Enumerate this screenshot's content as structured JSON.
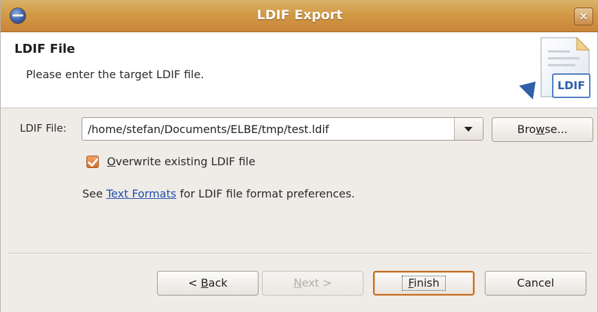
{
  "window": {
    "title": "LDIF Export",
    "close_label": "×"
  },
  "header": {
    "title": "LDIF File",
    "description": "Please enter the target LDIF file.",
    "graphic_label": "LDIF"
  },
  "file_field": {
    "label": "LDIF File:",
    "value": "/home/stefan/Documents/ELBE/tmp/test.ldif"
  },
  "browse_button": {
    "pre": "Bro",
    "mnemonic": "w",
    "post": "se..."
  },
  "overwrite": {
    "checked": true,
    "label_mnemonic": "O",
    "label_rest": "verwrite existing LDIF file"
  },
  "info": {
    "prefix": "See ",
    "link": "Text Formats",
    "suffix": " for LDIF file format preferences."
  },
  "buttons": {
    "back": {
      "pre": "< ",
      "mnemonic": "B",
      "post": "ack",
      "enabled": true
    },
    "next": {
      "pre": "",
      "mnemonic": "N",
      "post": "ext >",
      "enabled": false
    },
    "finish": {
      "pre": "",
      "mnemonic": "F",
      "post": "inish",
      "enabled": true,
      "default": true
    },
    "cancel": {
      "label": "Cancel",
      "enabled": true
    }
  }
}
